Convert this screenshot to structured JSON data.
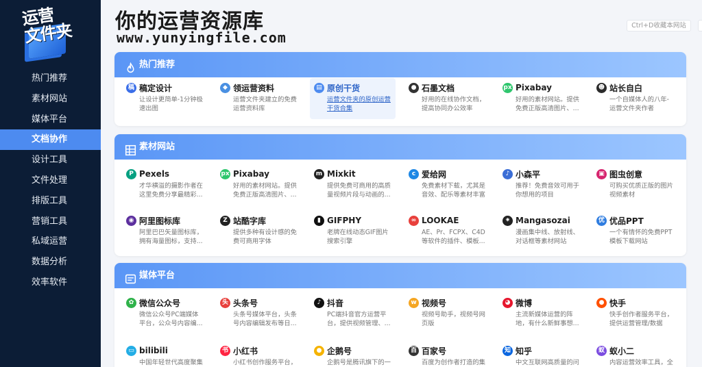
{
  "logo": {
    "text_line1": "运营",
    "text_line2": "文件夹"
  },
  "nav": [
    {
      "label": "热门推荐",
      "active": false
    },
    {
      "label": "素材网站",
      "active": false
    },
    {
      "label": "媒体平台",
      "active": false
    },
    {
      "label": "文档协作",
      "active": true
    },
    {
      "label": "设计工具",
      "active": false
    },
    {
      "label": "文件处理",
      "active": false
    },
    {
      "label": "排版工具",
      "active": false
    },
    {
      "label": "营销工具",
      "active": false
    },
    {
      "label": "私域运营",
      "active": false
    },
    {
      "label": "数据分析",
      "active": false
    },
    {
      "label": "效率软件",
      "active": false
    }
  ],
  "header": {
    "title": "你的运营资源库",
    "url": "www.yunyingfile.com",
    "bookmark": "Ctrl+D收藏本网站"
  },
  "sections": [
    {
      "title": "热门推荐",
      "icon": "flame-icon",
      "items": [
        {
          "title": "稿定设计",
          "desc": "让设计更简单-1分钟极速出图",
          "icon": "gaoding-icon",
          "color": "#3a6ee8",
          "glyph": "稿"
        },
        {
          "title": "领运营资料",
          "desc": "运营文件夹建立的免费运营资料库",
          "icon": "folder-icon",
          "color": "#4a90e2",
          "glyph": "◆"
        },
        {
          "title": "原创干货",
          "desc": "运营文件夹的原创运营干货合集",
          "icon": "document-icon",
          "color": "#4d8bf0",
          "glyph": "▤",
          "highlight": true
        },
        {
          "title": "石墨文档",
          "desc": "好用的在线协作文档，提高协同办公效率",
          "icon": "shimo-icon",
          "color": "#333333",
          "glyph": "●"
        },
        {
          "title": "Pixabay",
          "desc": "好用的素材网站。提供免费正版高清图片、...",
          "icon": "pixabay-icon",
          "color": "#2ec66d",
          "glyph": "px"
        },
        {
          "title": "站长自白",
          "desc": "一个自媒体人的八年-运营文件夹作者",
          "icon": "avatar-icon",
          "color": "#2b2b2b",
          "glyph": "☻"
        }
      ]
    },
    {
      "title": "素材网站",
      "icon": "grid-icon",
      "items": [
        {
          "title": "Pexels",
          "desc": "才华横溢的摄影作者在这里免费分享最精彩...",
          "icon": "pexels-icon",
          "color": "#07a081",
          "glyph": "P"
        },
        {
          "title": "Pixabay",
          "desc": "好用的素材网站。提供免费正版高清图片、...",
          "icon": "pixabay-icon",
          "color": "#2ec66d",
          "glyph": "px"
        },
        {
          "title": "Mixkit",
          "desc": "提供免费可商用的高质量视频片段与动画的...",
          "icon": "mixkit-icon",
          "color": "#222222",
          "glyph": "m"
        },
        {
          "title": "爱给网",
          "desc": "免费素材下载，尤其是音效、配乐等素材丰富",
          "icon": "aigei-icon",
          "color": "#1e88e5",
          "glyph": "c"
        },
        {
          "title": "小森平",
          "desc": "推荐！免费音效可用于你想用的项目",
          "icon": "kosenhei-icon",
          "color": "#3b6ed6",
          "glyph": "♪"
        },
        {
          "title": "图虫创意",
          "desc": "可购买优质正版的图片视频素材",
          "icon": "tuchong-icon",
          "color": "#d6246e",
          "glyph": "▣"
        },
        {
          "title": "阿里图标库",
          "desc": "阿里巴巴矢量图标库，拥有海量图标，支持...",
          "icon": "iconfont-icon",
          "color": "#5c2f9e",
          "glyph": "◉"
        },
        {
          "title": "站酷字库",
          "desc": "提供多种有设计感的免费可商用字体",
          "icon": "zcool-icon",
          "color": "#222222",
          "glyph": "Z"
        },
        {
          "title": "GIFPHY",
          "desc": "老牌在线动态GIF图片搜索引擎",
          "icon": "giphy-icon",
          "color": "#111111",
          "glyph": "▮"
        },
        {
          "title": "LOOKAE",
          "desc": "AE、Pr、FCPX、C4D等软件的插件、模板...",
          "icon": "lookae-icon",
          "color": "#e8403c",
          "glyph": "∞"
        },
        {
          "title": "Mangasozai",
          "desc": "漫画集中线、放射线、对话框等素材网站",
          "icon": "mangasozai-icon",
          "color": "#222222",
          "glyph": "✷"
        },
        {
          "title": "优品PPT",
          "desc": "一个有情怀的免费PPT模板下载网站",
          "icon": "youpinppt-icon",
          "color": "#2f7de0",
          "glyph": "优"
        }
      ]
    },
    {
      "title": "媒体平台",
      "icon": "media-icon",
      "items": [
        {
          "title": "微信公众号",
          "desc": "微信公众号PC端媒体平台，公众号内容编...",
          "icon": "wechat-icon",
          "color": "#2fb24a",
          "glyph": "✿"
        },
        {
          "title": "头条号",
          "desc": "头条号媒体平台，头条号内容编辑发布等日...",
          "icon": "toutiao-icon",
          "color": "#e8403c",
          "glyph": "头"
        },
        {
          "title": "抖音",
          "desc": "PC端抖音官方运营平台，提供视频管理、...",
          "icon": "douyin-icon",
          "color": "#111111",
          "glyph": "♪"
        },
        {
          "title": "视频号",
          "desc": "视频号助手，视频号网页版",
          "icon": "channels-icon",
          "color": "#f5a623",
          "glyph": "w"
        },
        {
          "title": "微博",
          "desc": "主流新媒体运营的阵地，有什么新鲜事想...",
          "icon": "weibo-icon",
          "color": "#e6162d",
          "glyph": "◕"
        },
        {
          "title": "快手",
          "desc": "快手创作者服务平台，提供运营管理/数据分...",
          "icon": "kuaishou-icon",
          "color": "#ff5000",
          "glyph": "●"
        },
        {
          "title": "bilibili",
          "desc": "中国年轻世代高度聚集",
          "icon": "bilibili-icon",
          "color": "#23ade5",
          "glyph": "▭"
        },
        {
          "title": "小红书",
          "desc": "小红书创作服务平台，",
          "icon": "xiaohongshu-icon",
          "color": "#ff2442",
          "glyph": "书"
        },
        {
          "title": "企鹅号",
          "desc": "企鹅号是腾讯旗下的一",
          "icon": "penguin-icon",
          "color": "#f5b300",
          "glyph": "●"
        },
        {
          "title": "百家号",
          "desc": "百度为创作者打造的集",
          "icon": "baijiahao-icon",
          "color": "#333333",
          "glyph": "百"
        },
        {
          "title": "知乎",
          "desc": "中文互联网高质量的问",
          "icon": "zhihu-icon",
          "color": "#0a66e0",
          "glyph": "知"
        },
        {
          "title": "蚁小二",
          "desc": "内容运营效率工具，全",
          "icon": "yixiaoer-icon",
          "color": "#7b4ce0",
          "glyph": "蚁"
        }
      ]
    }
  ]
}
